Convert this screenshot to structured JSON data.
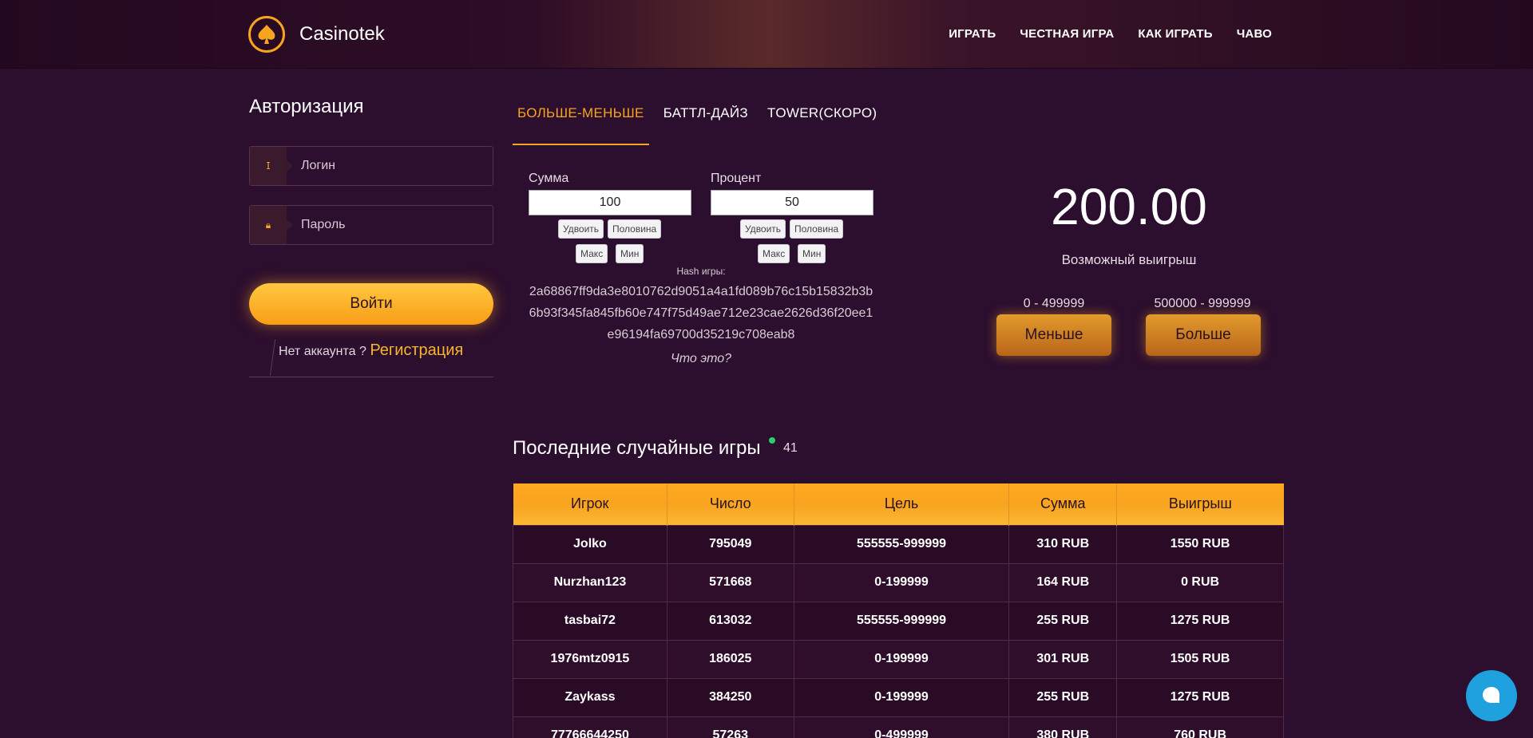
{
  "header": {
    "brand": "Casinotek",
    "nav": [
      "ИГРАТЬ",
      "ЧЕСТНАЯ ИГРА",
      "КАК ИГРАТЬ",
      "ЧАВО"
    ]
  },
  "auth": {
    "title": "Авторизация",
    "login_placeholder": "Логин",
    "password_placeholder": "Пароль",
    "login_button": "Войти",
    "no_account": "Нет аккаунта ?",
    "register_link": "Регистрация"
  },
  "tabs": [
    "БОЛЬШЕ-МЕНЬШЕ",
    "БАТТЛ-ДАЙЗ",
    "TOWER(СКОРО)"
  ],
  "game": {
    "sum_label": "Сумма",
    "sum_value": "100",
    "percent_label": "Процент",
    "percent_value": "50",
    "double": "Удвоить",
    "half": "Половина",
    "max": "Макс",
    "min": "Мин",
    "hash_label": "Hash игры:",
    "hash": "2a68867ff9da3e8010762d9051a4a1fd089b76c15b15832b3b6b93f345fa845fb60e747f75d49ae712e23cae2626d36f20ee1e96194fa69700d35219c708eab8",
    "what_is_it": "Что это?",
    "possible_win": "200.00",
    "possible_win_label": "Возможный выигрыш",
    "low_range": "0 - 499999",
    "high_range": "500000 - 999999",
    "less_button": "Меньше",
    "more_button": "Больше"
  },
  "recent": {
    "title": "Последние случайные игры",
    "online": "41",
    "columns": [
      "Игрок",
      "Число",
      "Цель",
      "Сумма",
      "Выигрыш"
    ],
    "rows": [
      [
        "Jolko",
        "795049",
        "555555-999999",
        "310 RUB",
        "1550 RUB"
      ],
      [
        "Nurzhan123",
        "571668",
        "0-199999",
        "164 RUB",
        "0 RUB"
      ],
      [
        "tasbai72",
        "613032",
        "555555-999999",
        "255 RUB",
        "1275 RUB"
      ],
      [
        "1976mtz0915",
        "186025",
        "0-199999",
        "301 RUB",
        "1505 RUB"
      ],
      [
        "Zaykass",
        "384250",
        "0-199999",
        "255 RUB",
        "1275 RUB"
      ],
      [
        "77766644250",
        "57263",
        "0-499999",
        "380 RUB",
        "760 RUB"
      ]
    ]
  },
  "colors": {
    "accent": "#f7a41f",
    "background": "#2c0e2e",
    "chat": "#1ea1de"
  }
}
